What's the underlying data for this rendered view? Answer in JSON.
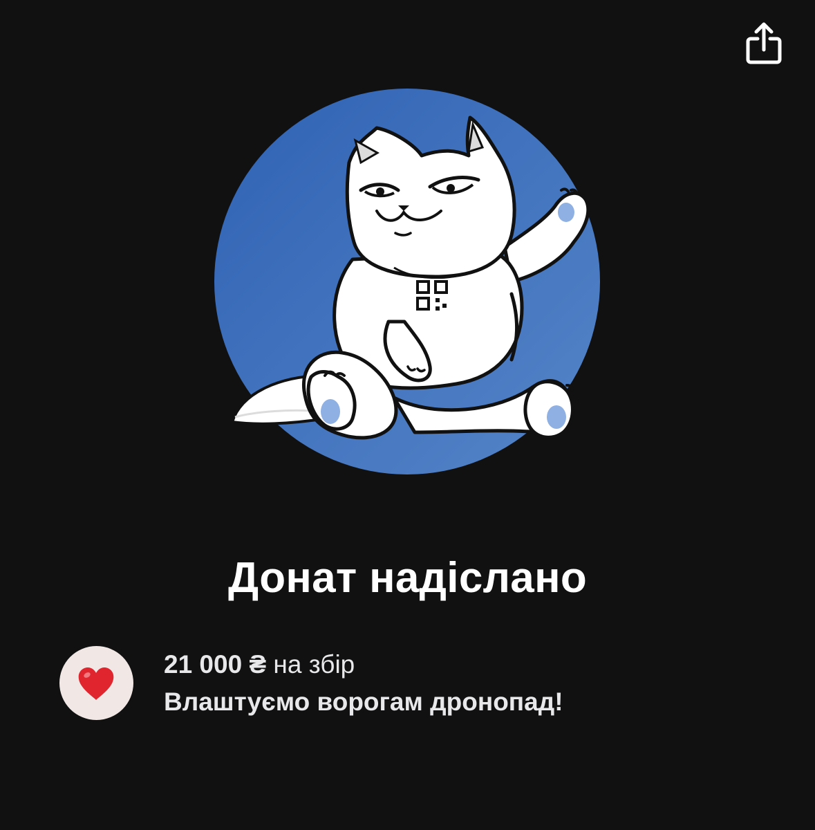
{
  "header": {
    "share_icon": "share-icon"
  },
  "hero": {
    "illustration": "cat-illustration",
    "circle_color": "#3d6fbd",
    "paw_color": "#8fb0e3"
  },
  "title": "Донат надіслано",
  "donation": {
    "icon": "heart-icon",
    "amount": "21 000 ₴",
    "suffix": " на збір",
    "jar_name": "Влаштуємо ворогам дронопад!",
    "badge_color": "#f1e8e6",
    "heart_color": "#e0252f"
  }
}
